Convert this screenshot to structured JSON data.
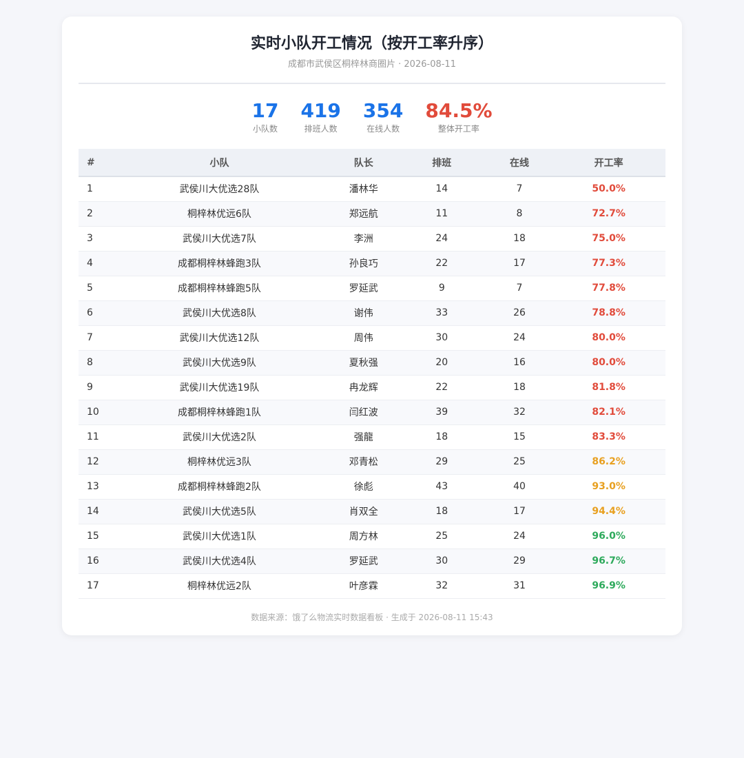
{
  "header": {
    "title": "实时小队开工情况（按开工率升序）",
    "subtitle": "成都市武侯区桐梓林商圈片 · 2026-08-11"
  },
  "stats": [
    {
      "value": "17",
      "label": "小队数",
      "color": "#1a73e8"
    },
    {
      "value": "419",
      "label": "排班人数",
      "color": "#1a73e8"
    },
    {
      "value": "354",
      "label": "在线人数",
      "color": "#1a73e8"
    },
    {
      "value": "84.5%",
      "label": "整体开工率",
      "color": "#e14b3b"
    }
  ],
  "colors": {
    "low": "#e14b3b",
    "mid": "#e8a020",
    "high": "#2eaa5c"
  },
  "table": {
    "columns": [
      "#",
      "小队",
      "队长",
      "排班",
      "在线",
      "开工率"
    ],
    "rows": [
      {
        "idx": "1",
        "team": "武侯川大优选28队",
        "leader": "潘林华",
        "scheduled": "14",
        "online": "7",
        "rate": "50.0%",
        "level": "low"
      },
      {
        "idx": "2",
        "team": "桐梓林优远6队",
        "leader": "郑远航",
        "scheduled": "11",
        "online": "8",
        "rate": "72.7%",
        "level": "low"
      },
      {
        "idx": "3",
        "team": "武侯川大优选7队",
        "leader": "李洲",
        "scheduled": "24",
        "online": "18",
        "rate": "75.0%",
        "level": "low"
      },
      {
        "idx": "4",
        "team": "成都桐梓林蜂跑3队",
        "leader": "孙良巧",
        "scheduled": "22",
        "online": "17",
        "rate": "77.3%",
        "level": "low"
      },
      {
        "idx": "5",
        "team": "成都桐梓林蜂跑5队",
        "leader": "罗延武",
        "scheduled": "9",
        "online": "7",
        "rate": "77.8%",
        "level": "low"
      },
      {
        "idx": "6",
        "team": "武侯川大优选8队",
        "leader": "谢伟",
        "scheduled": "33",
        "online": "26",
        "rate": "78.8%",
        "level": "low"
      },
      {
        "idx": "7",
        "team": "武侯川大优选12队",
        "leader": "周伟",
        "scheduled": "30",
        "online": "24",
        "rate": "80.0%",
        "level": "low"
      },
      {
        "idx": "8",
        "team": "武侯川大优选9队",
        "leader": "夏秋强",
        "scheduled": "20",
        "online": "16",
        "rate": "80.0%",
        "level": "low"
      },
      {
        "idx": "9",
        "team": "武侯川大优选19队",
        "leader": "冉龙辉",
        "scheduled": "22",
        "online": "18",
        "rate": "81.8%",
        "level": "low"
      },
      {
        "idx": "10",
        "team": "成都桐梓林蜂跑1队",
        "leader": "闫红波",
        "scheduled": "39",
        "online": "32",
        "rate": "82.1%",
        "level": "low"
      },
      {
        "idx": "11",
        "team": "武侯川大优选2队",
        "leader": "强龍",
        "scheduled": "18",
        "online": "15",
        "rate": "83.3%",
        "level": "low"
      },
      {
        "idx": "12",
        "team": "桐梓林优远3队",
        "leader": "邓青松",
        "scheduled": "29",
        "online": "25",
        "rate": "86.2%",
        "level": "mid"
      },
      {
        "idx": "13",
        "team": "成都桐梓林蜂跑2队",
        "leader": "徐彪",
        "scheduled": "43",
        "online": "40",
        "rate": "93.0%",
        "level": "mid"
      },
      {
        "idx": "14",
        "team": "武侯川大优选5队",
        "leader": "肖双全",
        "scheduled": "18",
        "online": "17",
        "rate": "94.4%",
        "level": "mid"
      },
      {
        "idx": "15",
        "team": "武侯川大优选1队",
        "leader": "周方林",
        "scheduled": "25",
        "online": "24",
        "rate": "96.0%",
        "level": "high"
      },
      {
        "idx": "16",
        "team": "武侯川大优选4队",
        "leader": "罗延武",
        "scheduled": "30",
        "online": "29",
        "rate": "96.7%",
        "level": "high"
      },
      {
        "idx": "17",
        "team": "桐梓林优远2队",
        "leader": "叶彦霖",
        "scheduled": "32",
        "online": "31",
        "rate": "96.9%",
        "level": "high"
      }
    ]
  },
  "footer": {
    "text": "数据来源：饿了么物流实时数据看板 · 生成于 2026-08-11 15:43"
  }
}
